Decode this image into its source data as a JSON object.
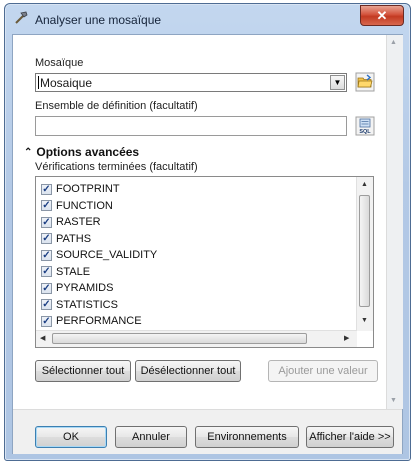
{
  "window": {
    "title": "Analyser une mosaïque",
    "close_glyph": "✕"
  },
  "form": {
    "mosaic_label": "Mosaïque",
    "mosaic_value": "Mosaique",
    "definition_label": "Ensemble de définition (facultatif)",
    "definition_value": "",
    "sql_icon_text": "SQL"
  },
  "advanced": {
    "heading": "Options avancées",
    "checks_label": "Vérifications terminées (facultatif)",
    "items": [
      {
        "label": "FOOTPRINT",
        "checked": true
      },
      {
        "label": "FUNCTION",
        "checked": true
      },
      {
        "label": "RASTER",
        "checked": true
      },
      {
        "label": "PATHS",
        "checked": true
      },
      {
        "label": "SOURCE_VALIDITY",
        "checked": true
      },
      {
        "label": "STALE",
        "checked": true
      },
      {
        "label": "PYRAMIDS",
        "checked": true
      },
      {
        "label": "STATISTICS",
        "checked": true
      },
      {
        "label": "PERFORMANCE",
        "checked": true
      }
    ],
    "select_all": "Sélectionner tout",
    "deselect_all": "Désélectionner tout",
    "add_value": "Ajouter une valeur"
  },
  "footer": {
    "ok": "OK",
    "cancel": "Annuler",
    "environments": "Environnements",
    "help": "Afficher l'aide >>"
  },
  "icons": {
    "app": "hammer-icon",
    "open_folder": "open-folder-icon",
    "sql": "sql-query-icon",
    "collapse": "double-chevron-up-icon"
  }
}
